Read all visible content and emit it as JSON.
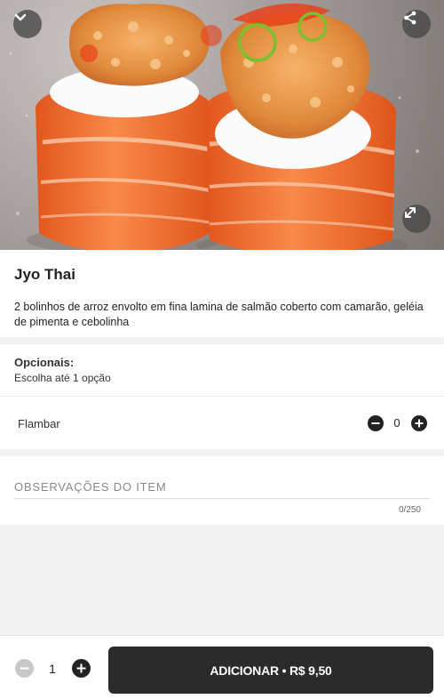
{
  "item": {
    "title": "Jyo Thai",
    "description": "2 bolinhos de arroz envolto em fina lamina de salmão coberto com camarão, geléia de pimenta e cebolinha"
  },
  "options": {
    "heading": "Opcionais:",
    "subheading": "Escolha até 1 opção",
    "items": [
      {
        "name": "Flambar",
        "count": "0"
      }
    ]
  },
  "notes": {
    "placeholder": "OBSERVAÇÕES DO ITEM",
    "counter": "0/250"
  },
  "footer": {
    "quantity": "1",
    "add_label": "ADICIONAR • R$ 9,50"
  },
  "colors": {
    "accent": "#2b2b2b",
    "salmon": "#f2742e",
    "background": "#f2f2f2"
  }
}
